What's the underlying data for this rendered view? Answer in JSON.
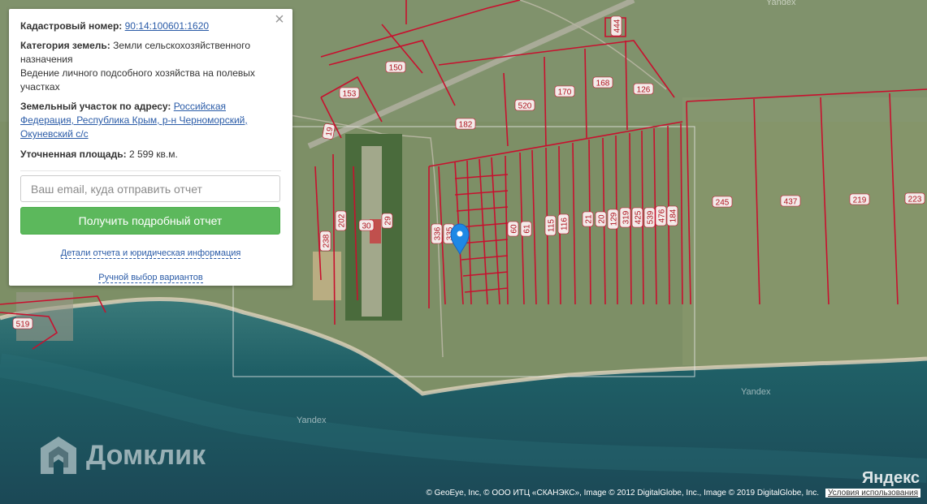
{
  "info": {
    "cadastral_label": "Кадастровый номер:",
    "cadastral_value": "90:14:100601:1620",
    "category_label": "Категория земель:",
    "category_value": "Земли сельскохозяйственного назначения",
    "usage": "Ведение личного подсобного хозяйства на полевых участках",
    "address_label": "Земельный участок по адресу:",
    "address_value": "Российская Федерация, Республика Крым, р-н Черноморский, Окуневский с/с",
    "area_label": "Уточненная площадь:",
    "area_value": "2 599 кв.м.",
    "close": "×"
  },
  "form": {
    "email_placeholder": "Ваш email, куда отправить отчет",
    "submit_label": "Получить подробный отчет",
    "details_link": "Детали отчета и юридическая информация",
    "manual_link": "Ручной выбор вариантов"
  },
  "map": {
    "parcel_labels": [
      "150",
      "153",
      "19",
      "520",
      "182",
      "170",
      "168",
      "126",
      "444",
      "202",
      "30",
      "29",
      "238",
      "336",
      "335",
      "60",
      "61",
      "115",
      "116",
      "21",
      "20",
      "129",
      "319",
      "425",
      "539",
      "476",
      "184",
      "245",
      "437",
      "219",
      "223",
      "519"
    ],
    "watermarks": [
      "Yandex",
      "Yandex",
      "Yandex"
    ],
    "brand": "Домклик",
    "yandex_logo": "Яндекс",
    "attribution": "© GeoEye, Inc, © ООО ИТЦ «СКАНЭКС», Image © 2012 DigitalGlobe, Inc., Image © 2019 DigitalGlobe, Inc.",
    "terms": "Условия использования",
    "colors": {
      "boundary": "#c8102e",
      "land": "#7d8f66",
      "sea": "#1f5a62",
      "button": "#5cb85c",
      "link": "#2a5ba7"
    }
  }
}
